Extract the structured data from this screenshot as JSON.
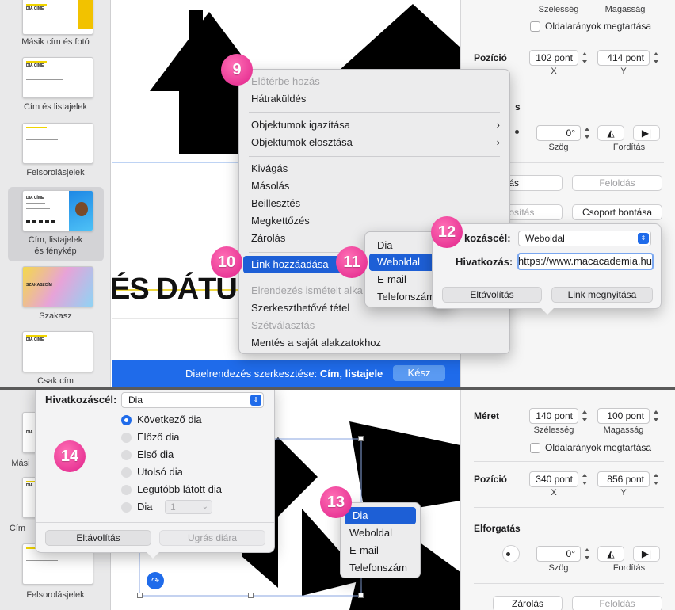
{
  "top": {
    "slides": [
      {
        "label": "Másik cím és fotó",
        "thumb_title": "DIA CÍME"
      },
      {
        "label": "Cím és listajelek",
        "thumb_title": "DIA CÍME"
      },
      {
        "label": "Felsorolásjelek",
        "thumb_title": ""
      },
      {
        "label": "Cím, listajelek\nés fénykép",
        "thumb_title": "DIA CÍME"
      },
      {
        "label": "Szakasz",
        "thumb_title": "SZAKASZCÍM"
      },
      {
        "label": "Csak cím",
        "thumb_title": "DIA CÍME"
      }
    ],
    "canvas": {
      "title_text": "ÉS DÁTUM",
      "edit_bar_prefix": "Diaelrendezés szerkesztése: ",
      "edit_bar_name": "Cím, listajele",
      "done_label": "Kész"
    },
    "inspector": {
      "width_label": "Szélesség",
      "height_label": "Magasság",
      "keep_ratio": "Oldalarányok megtartása",
      "position_label": "Pozíció",
      "x_value": "102 pont",
      "y_value": "414 pont",
      "x_label": "X",
      "y_label": "Y",
      "partial_heading": "s",
      "angle_value": "0°",
      "angle_label": "Szög",
      "flip_label": "Fordítás",
      "lock_btn": "rolás",
      "unlock_btn": "Feloldás",
      "group_btn": "rtosítás",
      "ungroup_btn": "Csoport bontása"
    },
    "context_menu": [
      {
        "label": "Előtérbe hozás",
        "disabled": true
      },
      {
        "label": "Hátraküldés"
      },
      {
        "label": "Objektumok igazítása",
        "submenu": true
      },
      {
        "label": "Objektumok elosztása",
        "submenu": true
      },
      {
        "label": "Kivágás"
      },
      {
        "label": "Másolás"
      },
      {
        "label": "Beillesztés"
      },
      {
        "label": "Megkettőzés"
      },
      {
        "label": "Zárolás"
      },
      {
        "label": "Link hozzáadása",
        "highlighted": true
      },
      {
        "label": "Elrendezés ismételt alka",
        "disabled": true
      },
      {
        "label": "Szerkeszthetővé tétel"
      },
      {
        "label": "Szétválasztás",
        "disabled": true
      },
      {
        "label": "Mentés a saját alakzatokhoz"
      }
    ],
    "link_submenu": [
      "Dia",
      "Weboldal",
      "E-mail",
      "Telefonszám"
    ],
    "link_popover": {
      "target_label": "kozáscél:",
      "target_value": "Weboldal",
      "link_label": "Hivatkozás:",
      "link_value": "https://www.macacademia.hu",
      "remove": "Eltávolítás",
      "open": "Link megnyitása"
    },
    "badges": [
      "9",
      "10",
      "11",
      "12"
    ]
  },
  "bottom": {
    "slides": [
      {
        "label": "",
        "thumb_title": "DIA"
      },
      {
        "label": "Mási",
        "thumb_title": "DIA"
      },
      {
        "label": "Cím",
        "thumb_title": "DIA"
      },
      {
        "label": "Felsorolásjelek",
        "thumb_title": ""
      }
    ],
    "popover": {
      "target_label": "Hivatkozáscél:",
      "target_value": "Dia",
      "options": [
        {
          "label": "Következő dia",
          "selected": true
        },
        {
          "label": "Előző dia"
        },
        {
          "label": "Első dia"
        },
        {
          "label": "Utolsó dia"
        },
        {
          "label": "Legutóbb látott dia"
        },
        {
          "label": "Dia"
        }
      ],
      "slide_number": "1",
      "remove": "Eltávolítás",
      "jump": "Ugrás diára"
    },
    "target_menu": [
      "Dia",
      "Weboldal",
      "E-mail",
      "Telefonszám"
    ],
    "inspector": {
      "size_label": "Méret",
      "width_value": "140 pont",
      "height_value": "100 pont",
      "width_label": "Szélesség",
      "height_label": "Magasság",
      "keep_ratio": "Oldalarányok megtartása",
      "position_label": "Pozíció",
      "x_value": "340 pont",
      "y_value": "856 pont",
      "x_label": "X",
      "y_label": "Y",
      "rotation_label": "Elforgatás",
      "angle_value": "0°",
      "angle_label": "Szög",
      "flip_label": "Fordítás",
      "lock_btn": "Zárolás",
      "unlock_btn": "Feloldás"
    },
    "badges": [
      "13",
      "14"
    ]
  }
}
